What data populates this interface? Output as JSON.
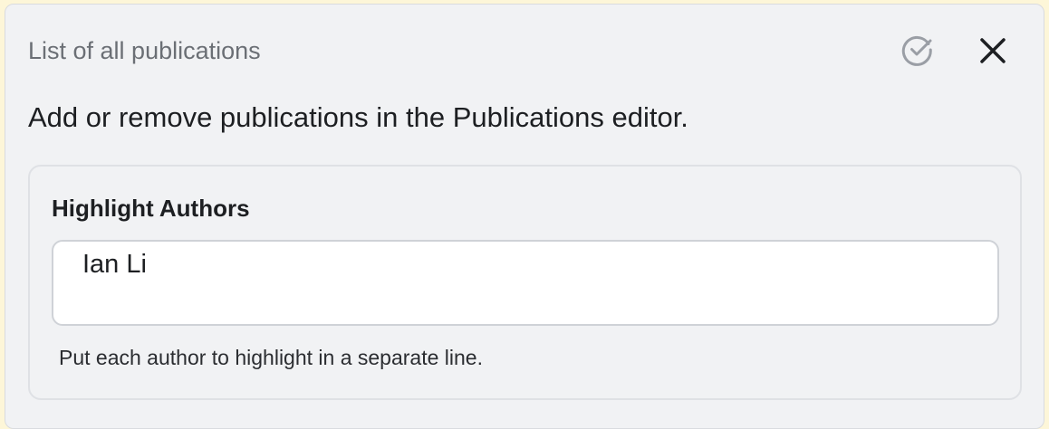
{
  "panel": {
    "title": "List of all publications",
    "description": "Add or remove publications in the Publications editor.",
    "icons": {
      "confirm": "check-circle-icon",
      "close": "close-icon"
    }
  },
  "field": {
    "label": "Highlight Authors",
    "value": "Ian Li",
    "placeholder": "",
    "helper": "Put each author to highlight in a separate line."
  },
  "colors": {
    "panel_bg": "#f1f2f4",
    "title_gray": "#6b6f75",
    "icon_gray": "#9a9ea5",
    "text_dark": "#1d1f22"
  }
}
